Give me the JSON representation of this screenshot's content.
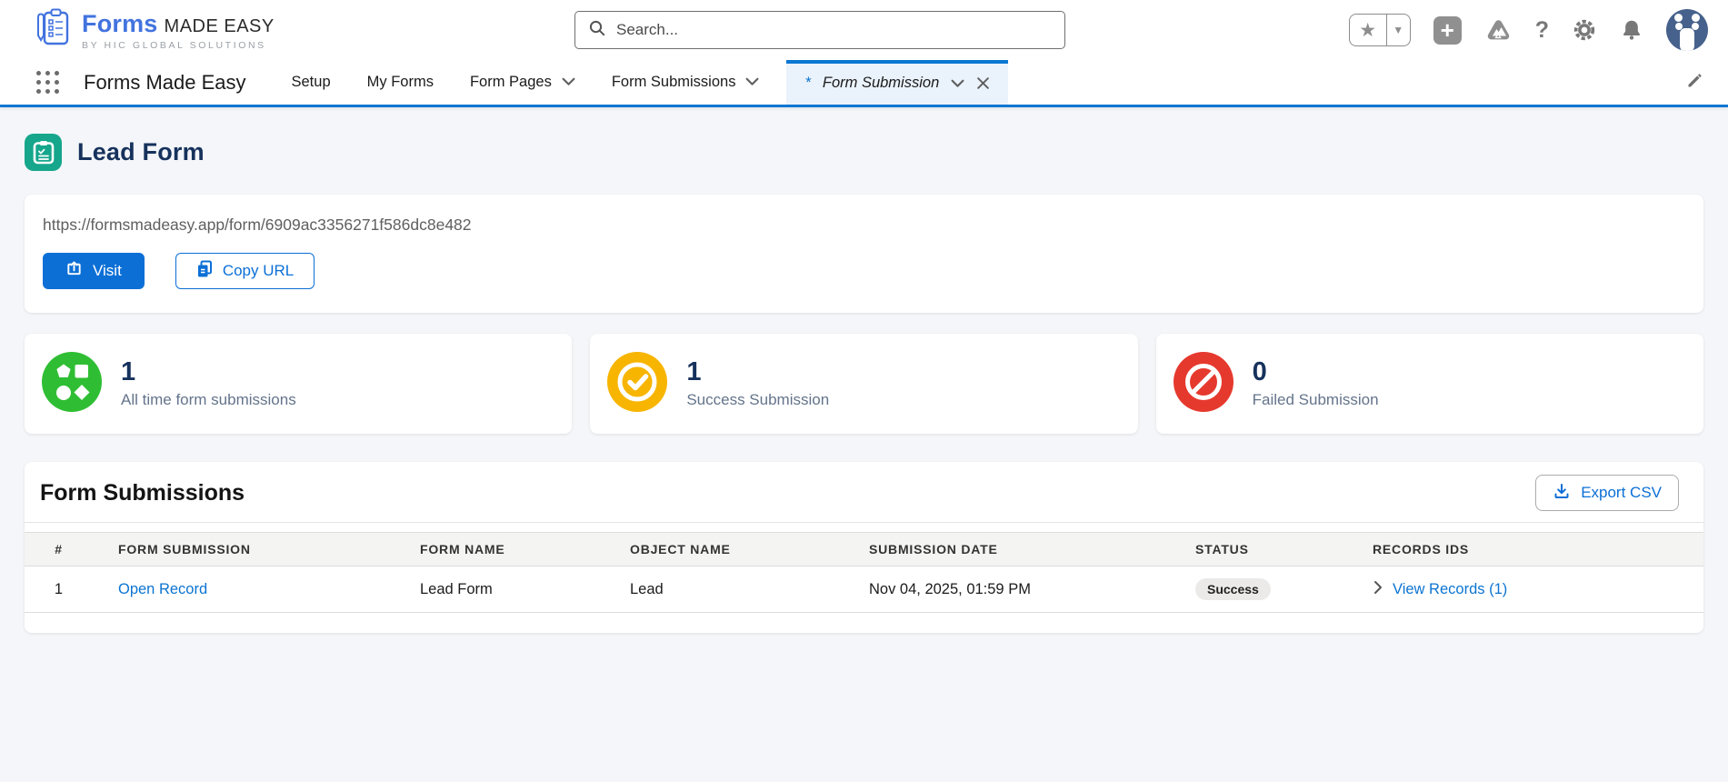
{
  "logo": {
    "brand": "Forms",
    "brand_suffix": "MADE EASY",
    "tagline": "BY HIC GLOBAL SOLUTIONS"
  },
  "search": {
    "placeholder": "Search..."
  },
  "nav": {
    "app_name": "Forms Made Easy",
    "items": [
      {
        "label": "Setup"
      },
      {
        "label": "My Forms"
      },
      {
        "label": "Form Pages"
      },
      {
        "label": "Form Submissions"
      }
    ],
    "active_tab": {
      "dirty_marker": "*",
      "label": "Form Submission"
    }
  },
  "page": {
    "title": "Lead Form"
  },
  "url_card": {
    "url": "https://formsmadeasy.app/form/6909ac3356271f586dc8e482",
    "visit_label": "Visit",
    "copy_label": "Copy URL"
  },
  "stats": [
    {
      "value": "1",
      "label": "All time form submissions",
      "color": "#2fbe33"
    },
    {
      "value": "1",
      "label": "Success Submission",
      "color": "#f7b500"
    },
    {
      "value": "0",
      "label": "Failed Submission",
      "color": "#e6392e"
    }
  ],
  "submissions": {
    "title": "Form Submissions",
    "export_label": "Export CSV",
    "columns": [
      "#",
      "FORM SUBMISSION",
      "FORM NAME",
      "OBJECT NAME",
      "SUBMISSION DATE",
      "STATUS",
      "RECORDS IDS"
    ],
    "rows": [
      {
        "num": "1",
        "record_link": "Open Record",
        "form_name": "Lead Form",
        "object_name": "Lead",
        "submission_date": "Nov 04, 2025, 01:59 PM",
        "status": "Success",
        "records_link": "View Records (1)"
      }
    ]
  },
  "colors": {
    "accent_blue": "#0b74d1",
    "nav_underline": "#0b76d3",
    "title_navy": "#16325c",
    "page_bg": "#f4f6f9",
    "success_green": "#2fbe33",
    "warn_yellow": "#f7b500",
    "fail_red": "#e6392e",
    "page_icon_teal": "#16a68c"
  }
}
